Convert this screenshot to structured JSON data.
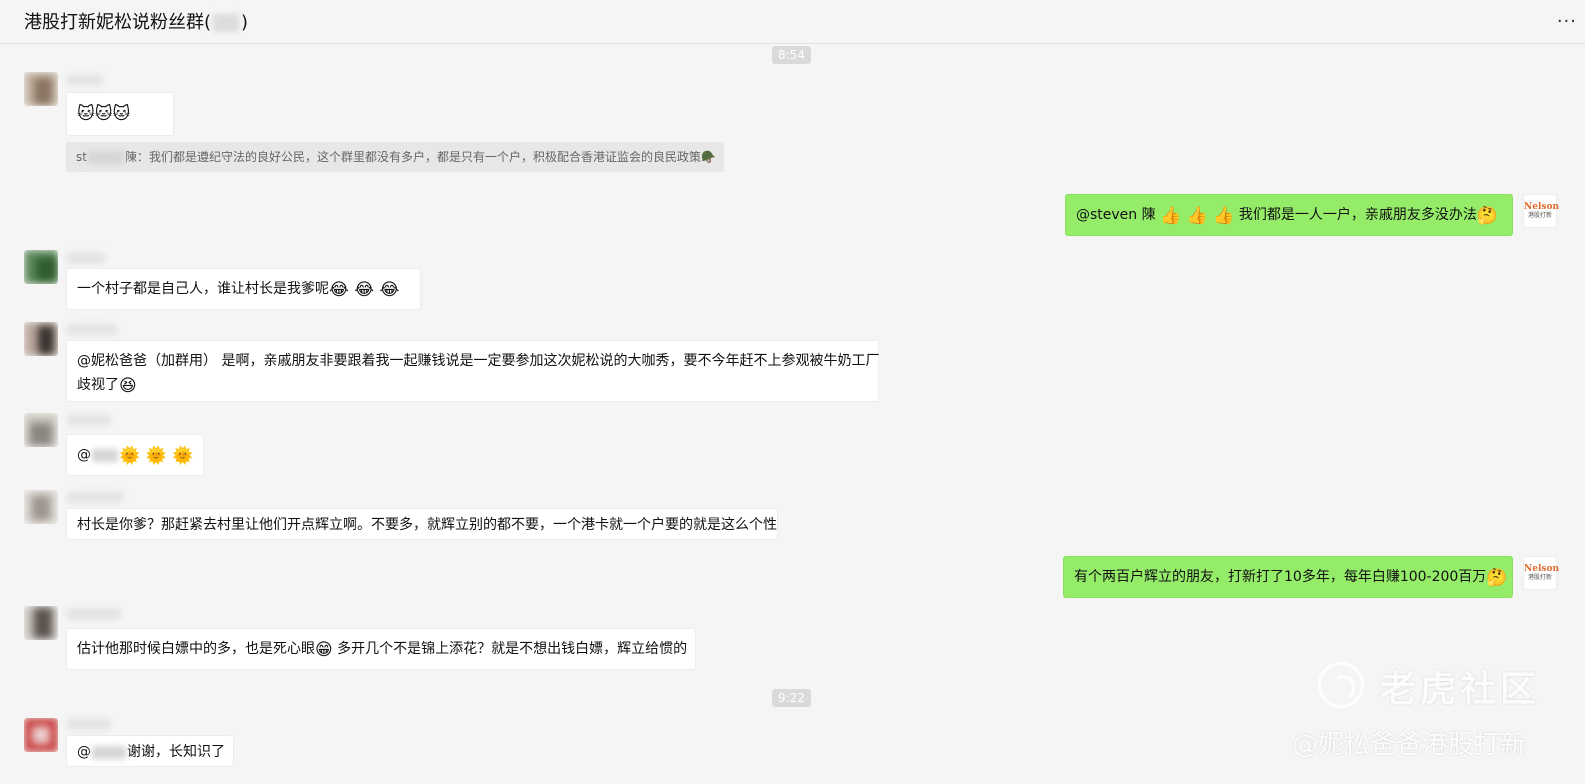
{
  "header": {
    "title": "港股打新妮松说粉丝群",
    "title_paren_open": "(",
    "title_paren_close": ")",
    "more": "..."
  },
  "timestamps": [
    "8:54",
    "9:22"
  ],
  "messages": [
    {
      "side": "left",
      "emoji": "🐱🐱🐱"
    },
    {
      "quote": {
        "name_start": "st",
        "name_end": "陳",
        "text": "：我们都是遵纪守法的良好公民，这个群里都没有多户，都是只有一个户，积极配合香港证监会的良民政策",
        "emoji": "🪖"
      }
    },
    {
      "side": "right",
      "text_prefix": "@steven 陳 ",
      "emoji_a": "👍 👍 👍",
      "text": " 我们都是一人一户，亲戚朋友多没办法",
      "emoji_b": "🤔"
    },
    {
      "side": "left",
      "text": "一个村子都是自己人，谁让村长是我爹呢",
      "emoji": "😂 😂 😂"
    },
    {
      "side": "left",
      "line1": "@妮松爸爸（加群用） 是啊，亲戚朋友非要跟着我一起赚钱说是一定要参加这次妮松说的大咖秀，要不今年赶不上参观被牛奶工厂",
      "line2": "歧视了",
      "emoji": "😆"
    },
    {
      "side": "left",
      "text": "@",
      "emoji": "🌞 🌞 🌞"
    },
    {
      "side": "left",
      "text": "村长是你爹？那赶紧去村里让他们开点辉立啊。不要多，就辉立别的都不要，一个港卡就一个户要的就是这么个性"
    },
    {
      "side": "right",
      "text": "有个两百户辉立的朋友，打新打了10多年，每年白赚100-200百万",
      "emoji": "🤔"
    },
    {
      "side": "left",
      "text_a": "估计他那时候白嫖中的多，也是死心眼",
      "emoji": "😁",
      "text_b": " 多开几个不是锦上添花？就是不想出钱白嫖，辉立给惯的"
    },
    {
      "side": "left",
      "text_a": "@",
      "text_b": "谢谢，长知识了"
    }
  ],
  "my_avatar": {
    "logo": "Nelson",
    "sub": "港股打新"
  },
  "watermark": {
    "brand": "老虎社区",
    "handle": "@妮松爸爸港股打新"
  },
  "colors": {
    "background": "#f5f5f5",
    "my_bubble": "#95ec69",
    "other_bubble": "#ffffff"
  }
}
